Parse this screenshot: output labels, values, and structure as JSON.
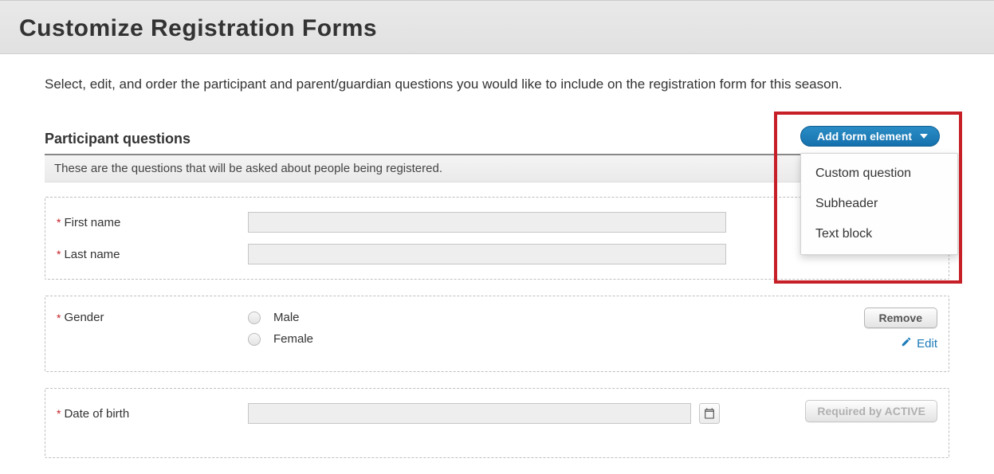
{
  "page_title": "Customize Registration Forms",
  "intro_text": "Select, edit, and order the participant and parent/guardian questions you would like to include on the registration form for this season.",
  "section_title": "Participant questions",
  "add_button_label": "Add form element",
  "dropdown_options": [
    "Custom question",
    "Subheader",
    "Text block"
  ],
  "section_description": "These are the questions that will be asked about people being registered.",
  "fields": {
    "first_name_label": "First name",
    "last_name_label": "Last name",
    "gender_label": "Gender",
    "male_label": "Male",
    "female_label": "Female",
    "dob_label": "Date of birth"
  },
  "buttons": {
    "remove": "Remove",
    "edit": "Edit",
    "required_by_active": "Required by ACTIVE"
  }
}
